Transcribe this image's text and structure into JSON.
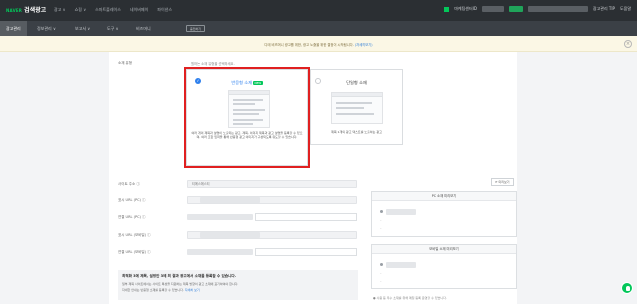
{
  "topbar": {
    "logo_brand": "NAVER",
    "logo_title": "검색광고",
    "menu": [
      "광고 ∨",
      "쇼핑 ∨",
      "스마트플레이스",
      "네이버페이",
      "파이낸스"
    ],
    "account_label": "마케팅센터ID",
    "tip_label": "광고관리 TIP",
    "help_label": "도움말"
  },
  "nav2": {
    "items": [
      "광고관리",
      "정보관리 ∨",
      "보고서 ∨",
      "도구 ∨",
      "비즈머니"
    ],
    "new_label": "충전하기"
  },
  "notice": {
    "text": "디테 비즈머니 광고를 위한, 광고 노출을 위한 결정이 시작됩니다.",
    "link": "(자세히보기)"
  },
  "form": {
    "type_label": "소재 유형",
    "type_hint": "원하는 소재 유형을 선택하세요.",
    "option1": {
      "title": "반응형 소재",
      "badge": "NEW",
      "desc": "여러 개의 제목과 설명이 노출되는 광고. 제목, 이미지 제목과 광고 설명을 등록할 수 있으며, 여러 조합 입력을 통해 반응형 광고 이미지가 구성되도록 유도할 수 있습니다."
    },
    "option2": {
      "title": "단일형 소재",
      "desc": "제목 1개의 광고 텍스트를 노출하는 광고"
    },
    "site_label": "사이트 주소 ⓘ",
    "site_value": "티에스에스티",
    "display_url_pc": "표시 URL (PC) ⓘ",
    "link_url_pc": "연결 URL (PC) ⓘ",
    "display_url_mobile": "표시 URL (모바일) ⓘ",
    "link_url_mobile": "연결 URL (모바일) ⓘ"
  },
  "preview": {
    "button": "⟳ 미리보기",
    "pc_title": "PC 소재 미리보기",
    "mobile_title": "모바일 소재 미리보기"
  },
  "infobox": {
    "title": "최적화 3에 제목, 설명만 3에 최 결과 광고에서 소재를 등록할 수 있습니다.",
    "line1": "일부 제목 사이트에서는 사이트 특성을 지원하는 제목 방향이 광고 소재에 표기하여야 합니다.",
    "line2": "자세한 안내는 반응형 소재를 등록할 수 있습니다.",
    "link": "자세히 보기"
  },
  "footnote": "● 사용 등 우수 소재를 위해 매칭 등록 운영할 수 있습니다.",
  "colors": {
    "accent": "#03c75a",
    "highlight": "#e02020",
    "radio": "#2f80ed"
  }
}
